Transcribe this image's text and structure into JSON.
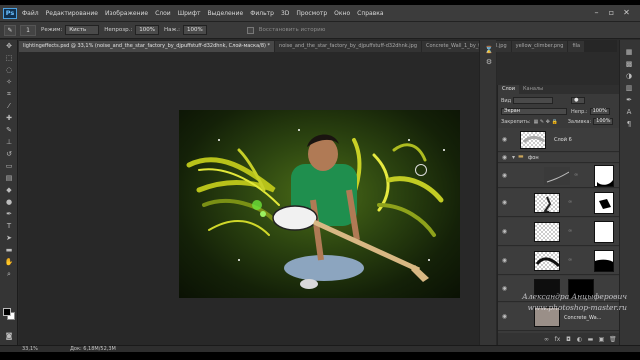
{
  "app": {
    "logo": "Ps"
  },
  "menu": [
    "Файл",
    "Редактирование",
    "Изображение",
    "Слои",
    "Шрифт",
    "Выделение",
    "Фильтр",
    "3D",
    "Просмотр",
    "Окно",
    "Справка"
  ],
  "options_bar": {
    "tool_icon": "brush-icon",
    "brush_size": "1",
    "mode_label": "Режим:",
    "mode_value": "Кисть",
    "opacity_label": "Непрозр.:",
    "opacity_value": "100%",
    "flow_label": "Наж.:",
    "flow_value": "100%",
    "erase_history_label": "Восстановить историю"
  },
  "tabs": [
    "lightingeffects.psd @ 33,1% (noise_and_the_star_factory_by_djpuffstuff-d32dhnk, Слой-маска/8) *",
    "noise_and_the_star_factory_by_djpuffstuff-d32dhnk.jpg",
    "Concrete_Wall_1_by_tenjprill.jpg",
    "yellow_climber.png",
    "fila"
  ],
  "status": {
    "zoom": "33,1%",
    "doc": "Док: 6,18М/52,3М"
  },
  "panel": {
    "tab_layers": "Слои",
    "tab_channels": "Каналы",
    "filter_label": "Вид",
    "blend_mode": "Экран",
    "opacity_label": "Непр.:",
    "opacity_value": "100%",
    "lock_label": "Закрепить:",
    "fill_label": "Заливка:",
    "fill_value": "100%",
    "layers": {
      "layer6": "Слой 6",
      "group": "фон",
      "concrete": "Concrete_Wa..."
    }
  },
  "watermark": {
    "line1": "Александра Анцыферович",
    "line2": "www.photoshop-master.ru"
  }
}
